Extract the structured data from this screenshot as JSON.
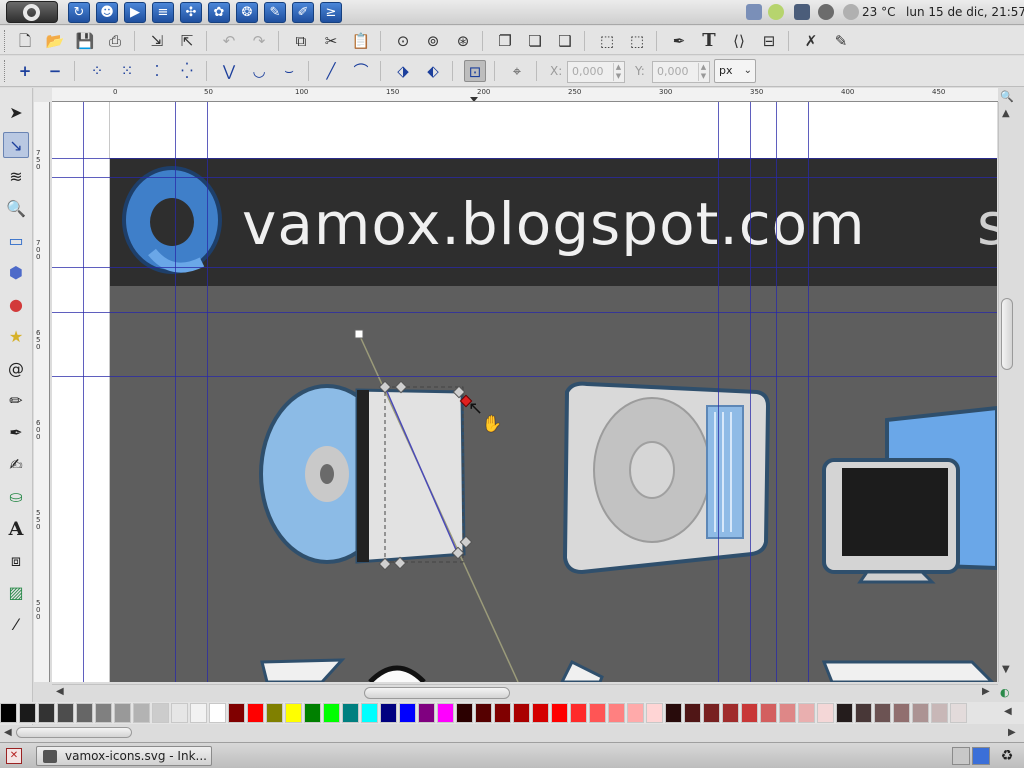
{
  "panel": {
    "temperature": "23 °C",
    "datetime": "lun 15 de dic, 21:57"
  },
  "toolbar": {
    "coord_x_label": "X:",
    "coord_x_value": "0,000",
    "coord_y_label": "Y:",
    "coord_y_value": "0,000",
    "unit": "px"
  },
  "ruler": {
    "h_labels": [
      "0",
      "50",
      "100",
      "150",
      "200",
      "250",
      "300",
      "350",
      "400",
      "450"
    ],
    "v_labels": [
      "750",
      "700",
      "650",
      "600",
      "550",
      "500"
    ]
  },
  "canvas": {
    "banner_text": "vamox.blogspot.com",
    "banner_extra": "s"
  },
  "taskbar": {
    "window_title": "vamox-icons.svg - Ink..."
  },
  "colors": {
    "guide": "#2a2aa8",
    "banner": "#2e2e2e",
    "background": "#5e5e5e"
  },
  "palette": [
    "#000000",
    "#1a1a1a",
    "#333333",
    "#4d4d4d",
    "#666666",
    "#808080",
    "#999999",
    "#b3b3b3",
    "#cccccc",
    "#e6e6e6",
    "#f2f2f2",
    "#ffffff",
    "#800000",
    "#ff0000",
    "#808000",
    "#ffff00",
    "#008000",
    "#00ff00",
    "#008080",
    "#00ffff",
    "#000080",
    "#0000ff",
    "#800080",
    "#ff00ff",
    "#2b0000",
    "#550000",
    "#800000",
    "#aa0000",
    "#d40000",
    "#ff0000",
    "#ff2a2a",
    "#ff5555",
    "#ff8080",
    "#ffaaaa",
    "#ffd5d5",
    "#280b0b",
    "#501616",
    "#782121",
    "#a02c2c",
    "#c83737",
    "#d35f5f",
    "#de8787",
    "#e9afaf",
    "#f4d7d7",
    "#241c1c",
    "#483737",
    "#6c5353",
    "#916f6f",
    "#ac9393",
    "#c8b7b7",
    "#e3dbdb"
  ]
}
